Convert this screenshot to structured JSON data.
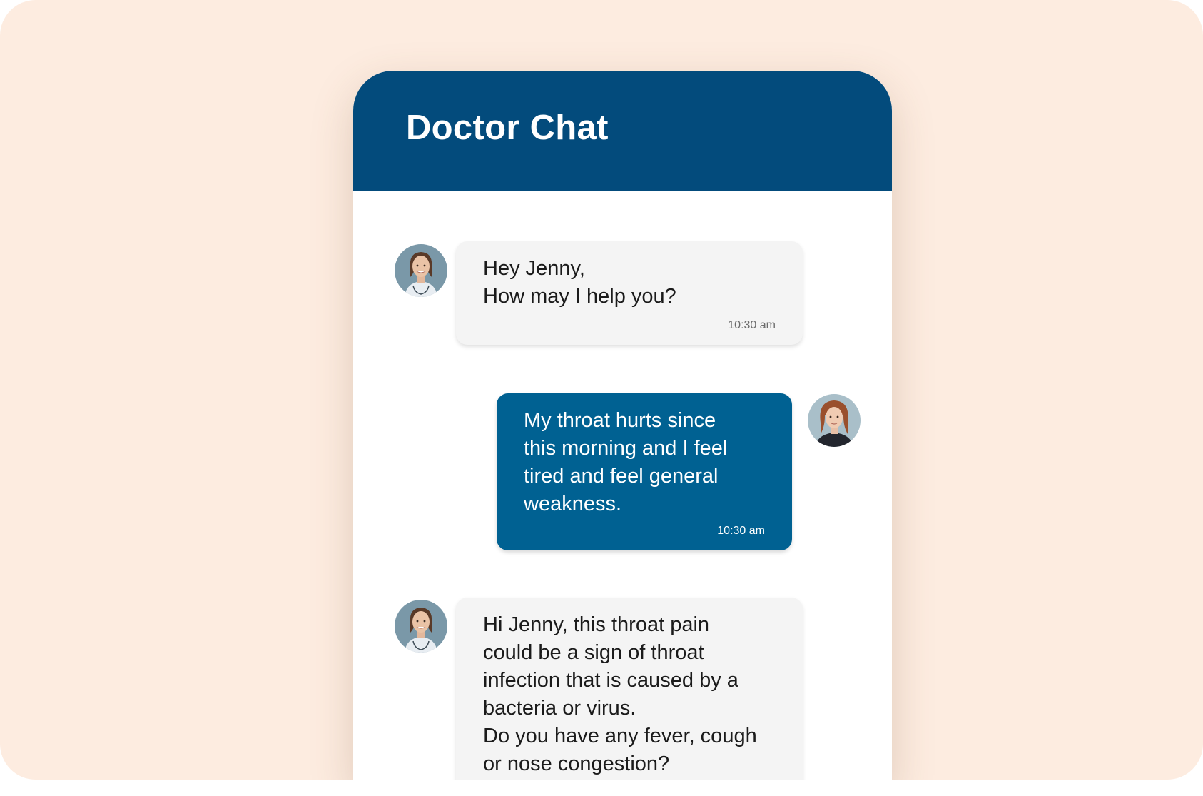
{
  "header": {
    "title": "Doctor Chat"
  },
  "messages": [
    {
      "sender": "doctor",
      "text": "Hey Jenny,\nHow may I help you?",
      "time": "10:30 am"
    },
    {
      "sender": "patient",
      "text": "My throat hurts since\nthis morning and I feel\ntired and feel general\nweakness.",
      "time": "10:30 am"
    },
    {
      "sender": "doctor",
      "text": "Hi Jenny, this throat pain\ncould be a sign of throat\ninfection that is caused by a\nbacteria or virus.\nDo you have any fever, cough\nor nose congestion?",
      "time": ""
    }
  ],
  "colors": {
    "background": "#fdece0",
    "header": "#034b7c",
    "outgoing_bubble": "#006192",
    "incoming_bubble": "#f4f4f4"
  },
  "icons": {
    "doctor_avatar": "doctor-avatar",
    "patient_avatar": "patient-avatar"
  }
}
